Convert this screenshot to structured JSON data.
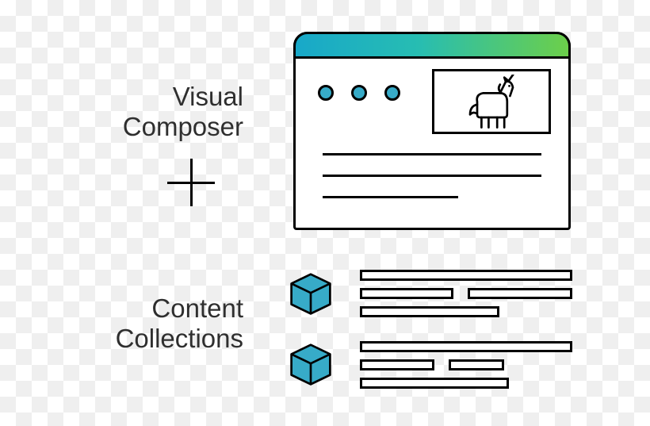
{
  "labels": {
    "top_line1": "Visual",
    "top_line2": "Composer",
    "bottom_line1": "Content",
    "bottom_line2": "Collections"
  },
  "colors": {
    "cube_fill": "#37abc8",
    "gradient_from": "#18a8c9",
    "gradient_to": "#6ccf4a"
  }
}
